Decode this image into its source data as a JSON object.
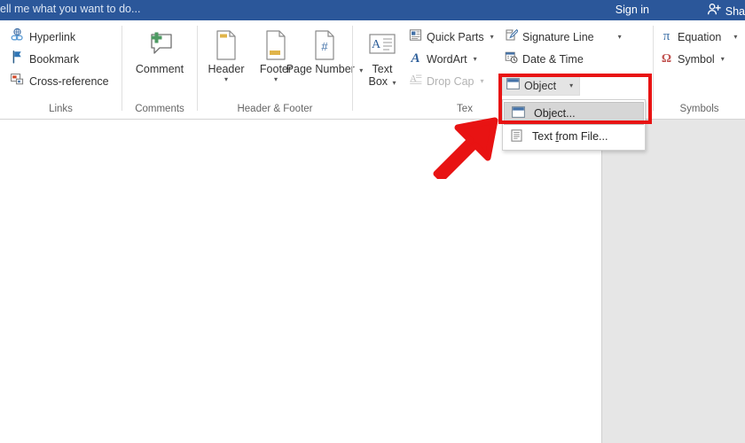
{
  "topbar": {
    "tell_me": "ell me what you want to do...",
    "sign_in": "Sign in",
    "share_label": "Sha",
    "share_icon": "person-add-icon",
    "background_color": "#2b579a"
  },
  "ribbon": {
    "groups": [
      {
        "name": "links",
        "label": "Links",
        "items": [
          {
            "label": "Hyperlink",
            "icon": "hyperlink-icon",
            "disabled": false,
            "has_caret": false
          },
          {
            "label": "Bookmark",
            "icon": "bookmark-flag-icon",
            "disabled": false,
            "has_caret": false
          },
          {
            "label": "Cross-reference",
            "icon": "cross-reference-icon",
            "disabled": false,
            "has_caret": false
          }
        ]
      },
      {
        "name": "comments",
        "label": "Comments",
        "items": [
          {
            "label": "Comment",
            "icon": "new-comment-icon",
            "disabled": false,
            "has_caret": false
          }
        ]
      },
      {
        "name": "header-footer",
        "label": "Header & Footer",
        "items": [
          {
            "label": "Header",
            "icon": "header-page-icon",
            "disabled": false,
            "has_caret": true
          },
          {
            "label": "Footer",
            "icon": "footer-page-icon",
            "disabled": false,
            "has_caret": true
          },
          {
            "label": "Page Number",
            "icon": "page-number-icon",
            "disabled": false,
            "has_caret": true
          }
        ]
      },
      {
        "name": "text",
        "label": "Tex",
        "full_label": "Text",
        "items": [
          {
            "label": "Text Box",
            "icon": "text-box-icon",
            "disabled": false,
            "has_caret": true
          },
          {
            "label": "Quick Parts",
            "icon": "quick-parts-icon",
            "disabled": false,
            "has_caret": true
          },
          {
            "label": "WordArt",
            "icon": "wordart-icon",
            "disabled": false,
            "has_caret": true
          },
          {
            "label": "Drop Cap",
            "icon": "drop-cap-icon",
            "disabled": true,
            "has_caret": true
          },
          {
            "label": "Signature Line",
            "icon": "signature-line-icon",
            "disabled": false,
            "has_caret": true
          },
          {
            "label": "Date & Time",
            "icon": "date-time-icon",
            "disabled": false,
            "has_caret": false
          },
          {
            "label": "Object",
            "icon": "object-icon",
            "disabled": false,
            "has_caret": true
          }
        ]
      },
      {
        "name": "symbols",
        "label": "Symbols",
        "items": [
          {
            "label": "Equation",
            "icon": "equation-pi-icon",
            "disabled": false,
            "has_caret": true
          },
          {
            "label": "Symbol",
            "icon": "symbol-omega-icon",
            "disabled": false,
            "has_caret": true
          }
        ]
      }
    ]
  },
  "object_button": {
    "label": "Object",
    "icon": "object-icon",
    "state": "pressed",
    "caret": "▾"
  },
  "dropdown": {
    "items": [
      {
        "label": "Object...",
        "icon": "object-icon",
        "highlighted": true,
        "accel_before": "Object...",
        "accel_char": "",
        "accel_after": ""
      },
      {
        "label": "Text from File...",
        "icon": "text-from-file-icon",
        "highlighted": false,
        "accel_before": "Text ",
        "accel_char": "f",
        "accel_after": "rom File..."
      }
    ]
  },
  "annotations": {
    "highlight_box_color": "#e81313",
    "arrow": {
      "name": "red-arrow-pointer",
      "color": "#e81313",
      "direction": "up-right"
    }
  },
  "document": {
    "page_background": "#ffffff",
    "canvas_background": "#e6e6e6"
  }
}
